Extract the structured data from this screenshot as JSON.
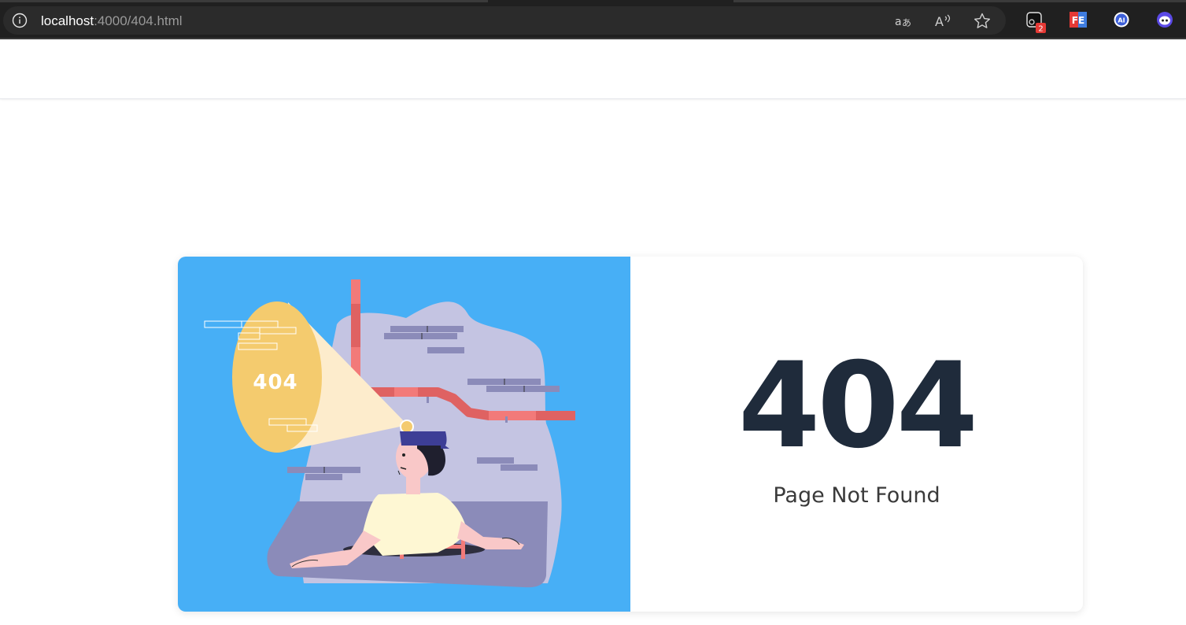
{
  "browser": {
    "url_host": "localhost",
    "url_rest": ":4000/404.html",
    "translate_icon": "translate-icon",
    "read_aloud_icon": "read-aloud-icon",
    "favorite_icon": "star-icon",
    "extensions": [
      {
        "name": "extension-camera-icon",
        "badge": "2"
      },
      {
        "name": "extension-fe-icon",
        "label": "FE"
      },
      {
        "name": "extension-ai-icon",
        "label": "AI"
      },
      {
        "name": "extension-face-icon"
      }
    ]
  },
  "error": {
    "illustration_text": "404",
    "code": "404",
    "message": "Page Not Found"
  },
  "colors": {
    "illustration_bg": "#47aff6",
    "code_text": "#1f2b3b",
    "pipe": "#f27a79",
    "wall": "#c4c4e2",
    "floor": "#8b8bb9",
    "spotlight": "#f4cb6e"
  }
}
